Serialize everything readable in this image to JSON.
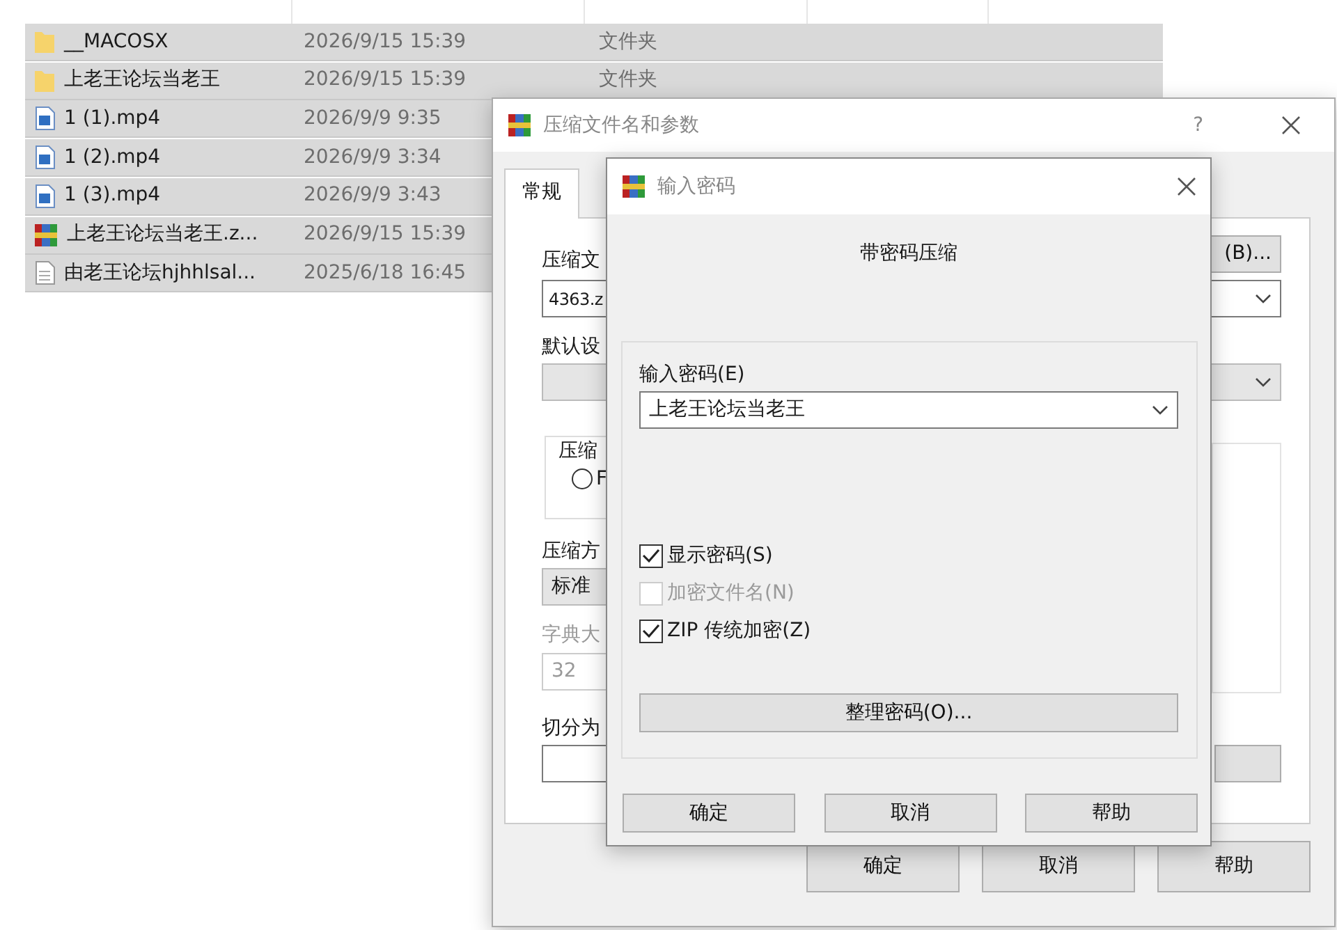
{
  "file_list": {
    "rows": [
      {
        "kind": "folder",
        "name": "__MACOSX",
        "date": "2026/9/15 15:39",
        "type": "文件夹",
        "selected": true
      },
      {
        "kind": "folder",
        "name": "上老王论坛当老王",
        "date": "2026/9/15 15:39",
        "type": "文件夹",
        "selected": true
      },
      {
        "kind": "video",
        "name": "1 (1).mp4",
        "date": "2026/9/9 9:35",
        "selected": true
      },
      {
        "kind": "video",
        "name": "1 (2).mp4",
        "date": "2026/9/9 3:34",
        "selected": true
      },
      {
        "kind": "video",
        "name": "1 (3).mp4",
        "date": "2026/9/9 3:43",
        "selected": true
      },
      {
        "kind": "archive",
        "name": "上老王论坛当老王.z...",
        "date": "2026/9/15 15:39",
        "selected": true
      },
      {
        "kind": "text",
        "name": "由老王论坛hjhhlsal...",
        "date": "2025/6/18 16:45",
        "selected": true
      }
    ]
  },
  "main_dialog": {
    "title": "压缩文件名和参数",
    "help": "?",
    "tabs": [
      {
        "label": "常规",
        "selected": true
      }
    ],
    "archive_name_label": "压缩文",
    "browse_button": "(B)...",
    "archive_name_value": "4363.z",
    "profile_label": "默认设",
    "format_group_label": "压缩",
    "format_options": [
      {
        "label": "F",
        "selected": false
      }
    ],
    "method_label": "压缩方",
    "method_value": "标准",
    "dictionary_label": "字典大",
    "dictionary_value": "32",
    "split_label": "切分为",
    "buttons": [
      "确定",
      "取消",
      "帮助"
    ]
  },
  "password_dialog": {
    "title": "输入密码",
    "heading": "带密码压缩",
    "password_label": "输入密码(E)",
    "password_value": "上老王论坛当老王",
    "checkboxes": [
      {
        "label": "显示密码(S)",
        "checked": true,
        "disabled": false
      },
      {
        "label": "加密文件名(N)",
        "checked": false,
        "disabled": true
      },
      {
        "label": "ZIP 传统加密(Z)",
        "checked": true,
        "disabled": false
      }
    ],
    "manage_button": "整理密码(O)...",
    "buttons": [
      "确定",
      "取消",
      "帮助"
    ]
  }
}
